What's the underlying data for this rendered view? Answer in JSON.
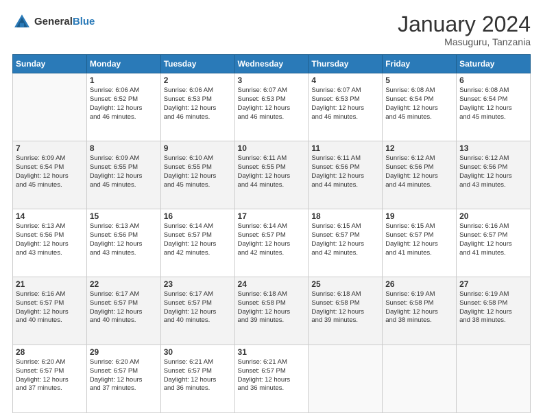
{
  "logo": {
    "general": "General",
    "blue": "Blue"
  },
  "title": "January 2024",
  "subtitle": "Masuguru, Tanzania",
  "days_of_week": [
    "Sunday",
    "Monday",
    "Tuesday",
    "Wednesday",
    "Thursday",
    "Friday",
    "Saturday"
  ],
  "weeks": [
    [
      {
        "day": "",
        "info": ""
      },
      {
        "day": "1",
        "info": "Sunrise: 6:06 AM\nSunset: 6:52 PM\nDaylight: 12 hours\nand 46 minutes."
      },
      {
        "day": "2",
        "info": "Sunrise: 6:06 AM\nSunset: 6:53 PM\nDaylight: 12 hours\nand 46 minutes."
      },
      {
        "day": "3",
        "info": "Sunrise: 6:07 AM\nSunset: 6:53 PM\nDaylight: 12 hours\nand 46 minutes."
      },
      {
        "day": "4",
        "info": "Sunrise: 6:07 AM\nSunset: 6:53 PM\nDaylight: 12 hours\nand 46 minutes."
      },
      {
        "day": "5",
        "info": "Sunrise: 6:08 AM\nSunset: 6:54 PM\nDaylight: 12 hours\nand 45 minutes."
      },
      {
        "day": "6",
        "info": "Sunrise: 6:08 AM\nSunset: 6:54 PM\nDaylight: 12 hours\nand 45 minutes."
      }
    ],
    [
      {
        "day": "7",
        "info": "Sunrise: 6:09 AM\nSunset: 6:54 PM\nDaylight: 12 hours\nand 45 minutes."
      },
      {
        "day": "8",
        "info": "Sunrise: 6:09 AM\nSunset: 6:55 PM\nDaylight: 12 hours\nand 45 minutes."
      },
      {
        "day": "9",
        "info": "Sunrise: 6:10 AM\nSunset: 6:55 PM\nDaylight: 12 hours\nand 45 minutes."
      },
      {
        "day": "10",
        "info": "Sunrise: 6:11 AM\nSunset: 6:55 PM\nDaylight: 12 hours\nand 44 minutes."
      },
      {
        "day": "11",
        "info": "Sunrise: 6:11 AM\nSunset: 6:56 PM\nDaylight: 12 hours\nand 44 minutes."
      },
      {
        "day": "12",
        "info": "Sunrise: 6:12 AM\nSunset: 6:56 PM\nDaylight: 12 hours\nand 44 minutes."
      },
      {
        "day": "13",
        "info": "Sunrise: 6:12 AM\nSunset: 6:56 PM\nDaylight: 12 hours\nand 43 minutes."
      }
    ],
    [
      {
        "day": "14",
        "info": "Sunrise: 6:13 AM\nSunset: 6:56 PM\nDaylight: 12 hours\nand 43 minutes."
      },
      {
        "day": "15",
        "info": "Sunrise: 6:13 AM\nSunset: 6:56 PM\nDaylight: 12 hours\nand 43 minutes."
      },
      {
        "day": "16",
        "info": "Sunrise: 6:14 AM\nSunset: 6:57 PM\nDaylight: 12 hours\nand 42 minutes."
      },
      {
        "day": "17",
        "info": "Sunrise: 6:14 AM\nSunset: 6:57 PM\nDaylight: 12 hours\nand 42 minutes."
      },
      {
        "day": "18",
        "info": "Sunrise: 6:15 AM\nSunset: 6:57 PM\nDaylight: 12 hours\nand 42 minutes."
      },
      {
        "day": "19",
        "info": "Sunrise: 6:15 AM\nSunset: 6:57 PM\nDaylight: 12 hours\nand 41 minutes."
      },
      {
        "day": "20",
        "info": "Sunrise: 6:16 AM\nSunset: 6:57 PM\nDaylight: 12 hours\nand 41 minutes."
      }
    ],
    [
      {
        "day": "21",
        "info": "Sunrise: 6:16 AM\nSunset: 6:57 PM\nDaylight: 12 hours\nand 40 minutes."
      },
      {
        "day": "22",
        "info": "Sunrise: 6:17 AM\nSunset: 6:57 PM\nDaylight: 12 hours\nand 40 minutes."
      },
      {
        "day": "23",
        "info": "Sunrise: 6:17 AM\nSunset: 6:57 PM\nDaylight: 12 hours\nand 40 minutes."
      },
      {
        "day": "24",
        "info": "Sunrise: 6:18 AM\nSunset: 6:58 PM\nDaylight: 12 hours\nand 39 minutes."
      },
      {
        "day": "25",
        "info": "Sunrise: 6:18 AM\nSunset: 6:58 PM\nDaylight: 12 hours\nand 39 minutes."
      },
      {
        "day": "26",
        "info": "Sunrise: 6:19 AM\nSunset: 6:58 PM\nDaylight: 12 hours\nand 38 minutes."
      },
      {
        "day": "27",
        "info": "Sunrise: 6:19 AM\nSunset: 6:58 PM\nDaylight: 12 hours\nand 38 minutes."
      }
    ],
    [
      {
        "day": "28",
        "info": "Sunrise: 6:20 AM\nSunset: 6:57 PM\nDaylight: 12 hours\nand 37 minutes."
      },
      {
        "day": "29",
        "info": "Sunrise: 6:20 AM\nSunset: 6:57 PM\nDaylight: 12 hours\nand 37 minutes."
      },
      {
        "day": "30",
        "info": "Sunrise: 6:21 AM\nSunset: 6:57 PM\nDaylight: 12 hours\nand 36 minutes."
      },
      {
        "day": "31",
        "info": "Sunrise: 6:21 AM\nSunset: 6:57 PM\nDaylight: 12 hours\nand 36 minutes."
      },
      {
        "day": "",
        "info": ""
      },
      {
        "day": "",
        "info": ""
      },
      {
        "day": "",
        "info": ""
      }
    ]
  ]
}
